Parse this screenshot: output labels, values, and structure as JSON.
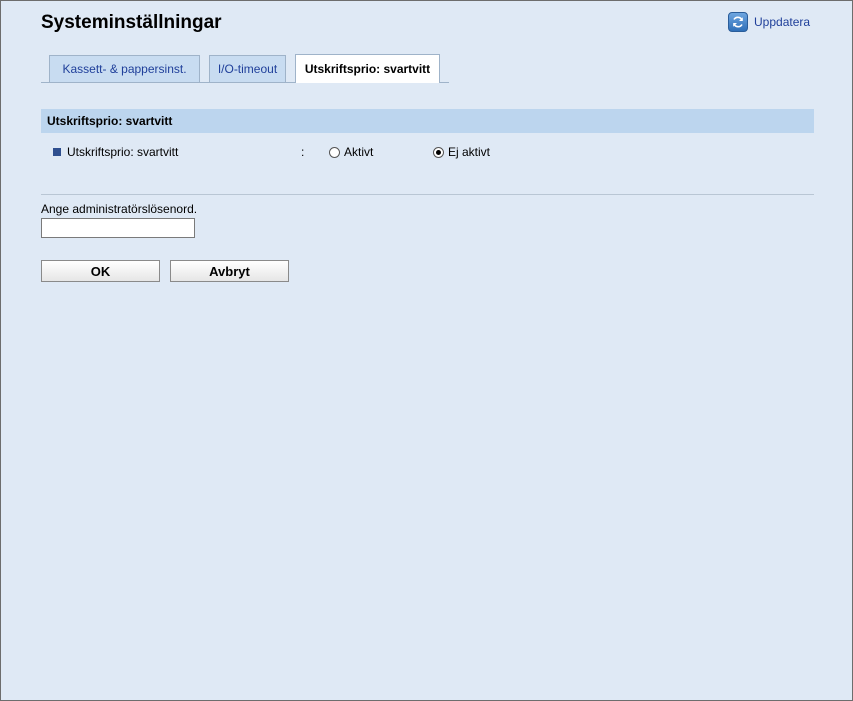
{
  "header": {
    "title": "Systeminställningar",
    "refresh_label": "Uppdatera"
  },
  "tabs": [
    {
      "label": "Kassett- & pappersinst.",
      "active": false
    },
    {
      "label": "I/O-timeout",
      "active": false
    },
    {
      "label": "Utskriftsprio: svartvitt",
      "active": true
    }
  ],
  "section": {
    "title": "Utskriftsprio: svartvitt",
    "setting": {
      "label": "Utskriftsprio: svartvitt",
      "separator": ":",
      "options": [
        {
          "label": "Aktivt",
          "checked": false
        },
        {
          "label": "Ej aktivt",
          "checked": true
        }
      ]
    }
  },
  "password": {
    "label": "Ange administratörslösenord.",
    "value": ""
  },
  "buttons": {
    "ok_label": "OK",
    "cancel_label": "Avbryt"
  },
  "colors": {
    "background": "#dfe9f5",
    "section_header": "#bcd5ee",
    "link": "#1f3f9a"
  },
  "icons": {
    "refresh": "refresh-icon",
    "bullet": "square-bullet-icon"
  }
}
